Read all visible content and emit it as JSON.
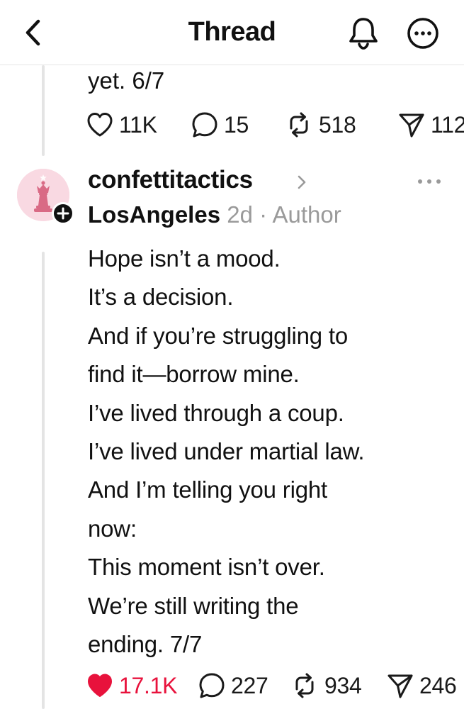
{
  "header": {
    "title": "Thread",
    "back_icon": "chevron-left-icon",
    "bell_icon": "bell-icon",
    "more_icon": "more-circle-icon"
  },
  "previous_post": {
    "text_tail": "yet. 6/7",
    "actions": {
      "likes": "11K",
      "replies": "15",
      "reposts": "518",
      "shares": "112"
    }
  },
  "post": {
    "username": "confettitactics",
    "location": "LosAngeles",
    "time": "2d",
    "separator": "·",
    "role": "Author",
    "lines": [
      "Hope isn’t a mood.",
      "It’s a decision.",
      "And if you’re struggling to",
      "find it—borrow mine.",
      "I’ve lived through a coup.",
      "I’ve lived under martial law.",
      "And I’m telling you right",
      "now:",
      "This moment isn’t over.",
      "We’re still writing the",
      "ending. 7/7"
    ],
    "actions": {
      "likes": "17.1K",
      "liked": true,
      "replies": "227",
      "reposts": "934",
      "shares": "246"
    }
  },
  "colors": {
    "liked": "#e8123c",
    "muted": "#9a9a9a",
    "thread_line": "#e4e4e4",
    "avatar_bg": "#f9d9e2",
    "chess_piece": "#d96a85"
  }
}
